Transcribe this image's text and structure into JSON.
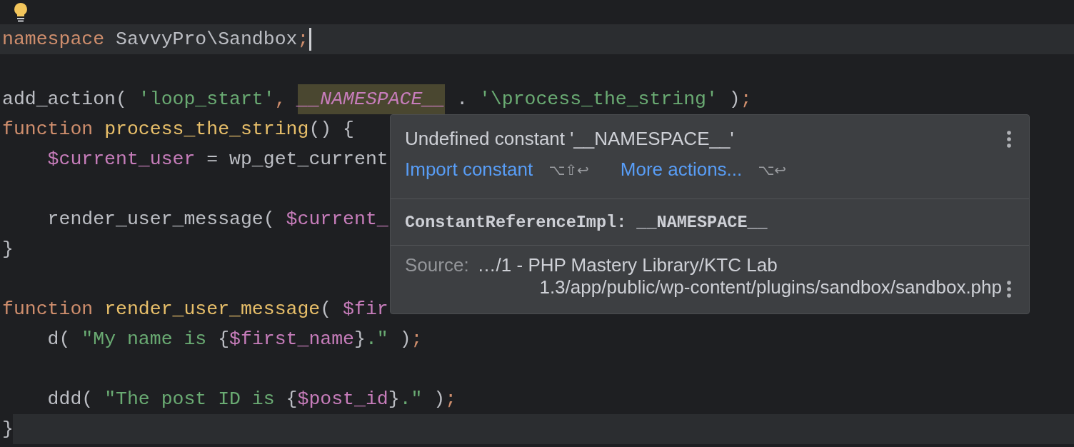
{
  "editor": {
    "lines": [
      {
        "kind": "code",
        "highlighted": true,
        "caret": true,
        "tokens": [
          {
            "kind": "kw",
            "text": "namespace"
          },
          {
            "kind": "plain",
            "text": " SavvyPro\\Sandbox"
          },
          {
            "kind": "semi",
            "text": ";"
          }
        ]
      },
      {
        "kind": "blank"
      },
      {
        "kind": "code",
        "highlighted": false,
        "caret": false,
        "tokens": [
          {
            "kind": "plain",
            "text": "add_action( "
          },
          {
            "kind": "str",
            "text": "'loop_start'"
          },
          {
            "kind": "semi",
            "text": ", "
          },
          {
            "kind": "const",
            "text": "__NAMESPACE__"
          },
          {
            "kind": "plain",
            "text": " . "
          },
          {
            "kind": "str",
            "text": "'\\process_the_string'"
          },
          {
            "kind": "plain",
            "text": " )"
          },
          {
            "kind": "semi",
            "text": ";"
          }
        ]
      },
      {
        "kind": "code",
        "highlighted": false,
        "caret": false,
        "tokens": [
          {
            "kind": "kw",
            "text": "function "
          },
          {
            "kind": "fn",
            "text": "process_the_string"
          },
          {
            "kind": "plain",
            "text": "() {"
          }
        ]
      },
      {
        "kind": "code",
        "highlighted": false,
        "caret": false,
        "tokens": [
          {
            "kind": "var",
            "text": "    $current_user"
          },
          {
            "kind": "plain",
            "text": " = wp_get_current"
          }
        ]
      },
      {
        "kind": "blank"
      },
      {
        "kind": "code",
        "highlighted": false,
        "caret": false,
        "tokens": [
          {
            "kind": "plain",
            "text": "    render_user_message( "
          },
          {
            "kind": "var",
            "text": "$current_"
          }
        ]
      },
      {
        "kind": "code",
        "highlighted": false,
        "caret": false,
        "tokens": [
          {
            "kind": "plain",
            "text": "}"
          }
        ]
      },
      {
        "kind": "blank"
      },
      {
        "kind": "code",
        "highlighted": false,
        "caret": false,
        "tokens": [
          {
            "kind": "kw",
            "text": "function "
          },
          {
            "kind": "fn",
            "text": "render_user_message"
          },
          {
            "kind": "plain",
            "text": "( "
          },
          {
            "kind": "var",
            "text": "$fir"
          }
        ]
      },
      {
        "kind": "code",
        "highlighted": false,
        "caret": false,
        "tokens": [
          {
            "kind": "plain",
            "text": "    d( "
          },
          {
            "kind": "str",
            "text": "\"My name is "
          },
          {
            "kind": "plain",
            "text": "{"
          },
          {
            "kind": "var",
            "text": "$first_name"
          },
          {
            "kind": "plain",
            "text": "}"
          },
          {
            "kind": "str",
            "text": ".\""
          },
          {
            "kind": "plain",
            "text": " )"
          },
          {
            "kind": "semi",
            "text": ";"
          }
        ]
      },
      {
        "kind": "blank"
      },
      {
        "kind": "code",
        "highlighted": false,
        "caret": false,
        "tokens": [
          {
            "kind": "plain",
            "text": "    ddd( "
          },
          {
            "kind": "str",
            "text": "\"The post ID is "
          },
          {
            "kind": "plain",
            "text": "{"
          },
          {
            "kind": "var",
            "text": "$post_id"
          },
          {
            "kind": "plain",
            "text": "}"
          },
          {
            "kind": "str",
            "text": ".\""
          },
          {
            "kind": "plain",
            "text": " )"
          },
          {
            "kind": "semi",
            "text": ";"
          }
        ]
      },
      {
        "kind": "code",
        "highlighted": true,
        "caret": false,
        "tokens": [
          {
            "kind": "plain",
            "text": "}"
          }
        ]
      }
    ]
  },
  "popup": {
    "title": "Undefined constant '__NAMESPACE__'",
    "actions": [
      {
        "label": "Import constant",
        "shortcut": "⌥⇧↩"
      },
      {
        "label": "More actions...",
        "shortcut": "⌥↩"
      }
    ],
    "element": "ConstantReferenceImpl: __NAMESPACE__",
    "source_label": "Source:",
    "source_lines": [
      "…/1 - PHP Mastery Library/KTC Lab",
      "1.3/app/public/wp-content/plugins/sandbox/sandbox.php"
    ]
  }
}
